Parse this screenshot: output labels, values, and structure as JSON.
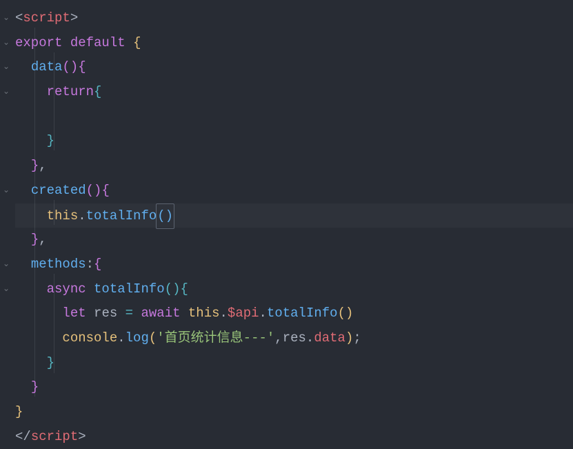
{
  "gutter": {
    "fold_open": "⌄"
  },
  "code": {
    "script_open_lt": "<",
    "script_open_name": "script",
    "script_open_gt": ">",
    "export": "export",
    "default": "default",
    "brace_open": "{",
    "brace_close": "}",
    "data_name": "data",
    "paren_open": "(",
    "paren_close": ")",
    "return": "return",
    "comma": ",",
    "created_name": "created",
    "this": "this",
    "dot": ".",
    "totalInfo": "totalInfo",
    "methods": "methods",
    "colon": ":",
    "async": "async",
    "let": "let",
    "res": "res",
    "eq": "=",
    "await": "await",
    "dollar_api": "$api",
    "console": "console",
    "log": "log",
    "string_msg": "'首页统计信息---'",
    "data_prop": "data",
    "semicolon": ";",
    "script_close_lt": "</",
    "script_close_name": "script",
    "script_close_gt": ">"
  }
}
